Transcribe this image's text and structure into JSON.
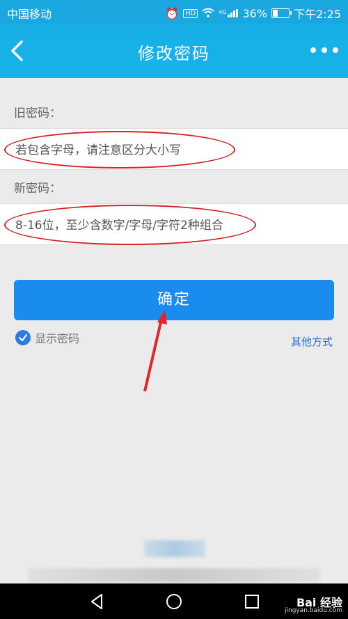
{
  "status": {
    "carrier": "中国移动",
    "signal_tag": "4G",
    "hd_tag": "HD",
    "battery": "36%",
    "time": "下午2:25"
  },
  "nav": {
    "title": "修改密码"
  },
  "form": {
    "old_label": "旧密码：",
    "old_placeholder": "若包含字母，请注意区分大小写",
    "new_label": "新密码：",
    "new_placeholder": "8-16位，至少含数字/字母/字符2种组合",
    "confirm": "确定",
    "show_password": "显示密码",
    "other_methods": "其他方式"
  },
  "watermark": {
    "brand": "Bai 经验",
    "url": "jingyan.baidu.com"
  },
  "colors": {
    "header": "#16b3ea",
    "button": "#1a8cf0",
    "annotation": "#d8232a"
  }
}
